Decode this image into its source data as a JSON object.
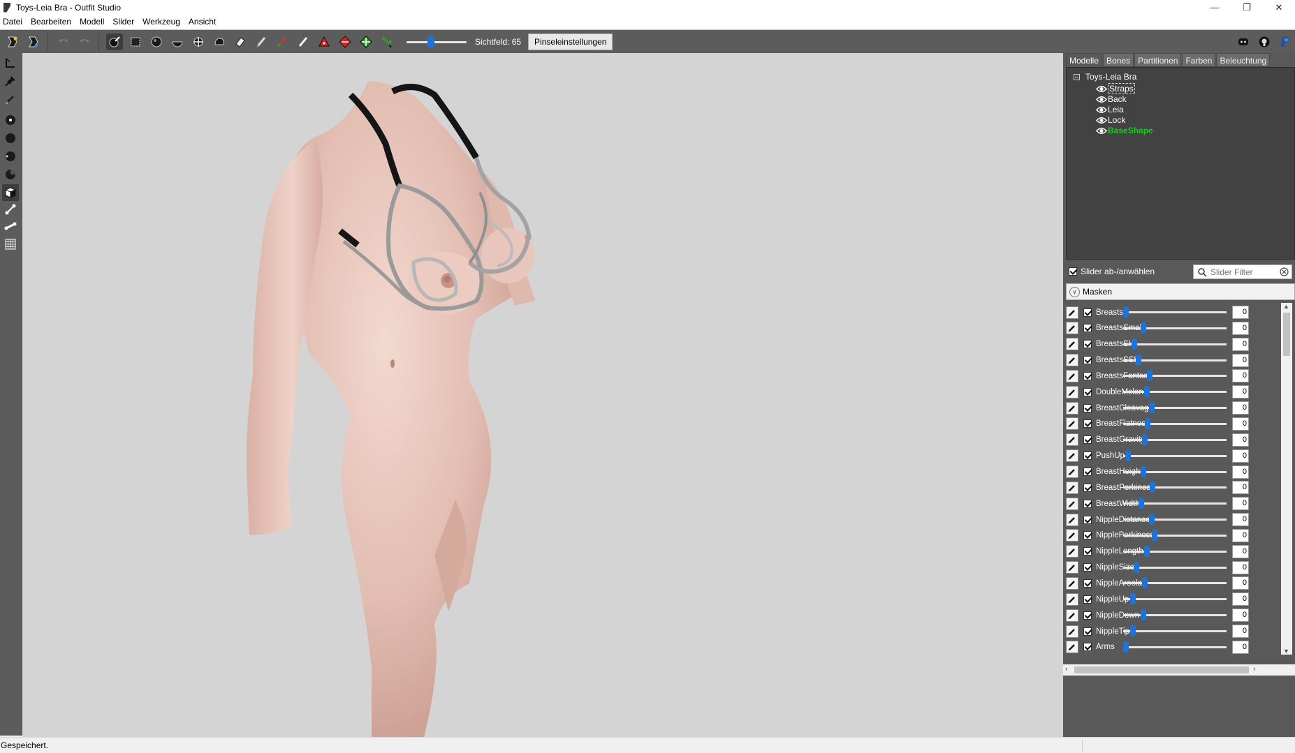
{
  "window": {
    "title": "Toys-Leia Bra - Outfit Studio",
    "minimize": "—",
    "maximize": "❐",
    "close": "✕"
  },
  "menu": [
    "Datei",
    "Bearbeiten",
    "Modell",
    "Slider",
    "Werkzeug",
    "Ansicht"
  ],
  "toolbar": {
    "fov_label": "Sichtfeld: 65",
    "fov_value": 65,
    "brush_settings": "Pinseleinstellungen"
  },
  "tabs": [
    "Modelle",
    "Bones",
    "Partitionen",
    "Farben",
    "Beleuchtung"
  ],
  "tree": {
    "root": "Toys-Leia Bra",
    "items": [
      {
        "label": "Straps",
        "selected": true
      },
      {
        "label": "Back"
      },
      {
        "label": "Leia"
      },
      {
        "label": "Lock"
      },
      {
        "label": "BaseShape",
        "reference": true
      }
    ]
  },
  "sliders_panel": {
    "select_all_label": "Slider ab-/anwählen",
    "filter_placeholder": "Slider Filter",
    "masks_label": "Masken"
  },
  "sliders": [
    {
      "name": "Breasts",
      "value": "0",
      "pos": 0.0
    },
    {
      "name": "BreastsSmall",
      "value": "0",
      "pos": 0.17
    },
    {
      "name": "BreastsSH",
      "value": "0",
      "pos": 0.08
    },
    {
      "name": "BreastsSSH",
      "value": "0",
      "pos": 0.12
    },
    {
      "name": "BreastsFantasy",
      "value": "0",
      "pos": 0.23
    },
    {
      "name": "DoubleMelon",
      "value": "0",
      "pos": 0.2
    },
    {
      "name": "BreastCleavage",
      "value": "0",
      "pos": 0.25
    },
    {
      "name": "BreastFlatness",
      "value": "0",
      "pos": 0.21
    },
    {
      "name": "BreastGravity",
      "value": "0",
      "pos": 0.18
    },
    {
      "name": "PushUp",
      "value": "0",
      "pos": 0.02
    },
    {
      "name": "BreastHeight",
      "value": "0",
      "pos": 0.17
    },
    {
      "name": "BreastPerkiness",
      "value": "0",
      "pos": 0.26
    },
    {
      "name": "BreastWidth",
      "value": "0",
      "pos": 0.15
    },
    {
      "name": "NippleDistance",
      "value": "0",
      "pos": 0.25
    },
    {
      "name": "NipplePerkiness",
      "value": "0",
      "pos": 0.28
    },
    {
      "name": "NippleLength",
      "value": "0",
      "pos": 0.2
    },
    {
      "name": "NippleSize",
      "value": "0",
      "pos": 0.1
    },
    {
      "name": "NippleAreola",
      "value": "0",
      "pos": 0.18
    },
    {
      "name": "NippleUp",
      "value": "0",
      "pos": 0.07
    },
    {
      "name": "NippleDown",
      "value": "0",
      "pos": 0.17
    },
    {
      "name": "NippleTip",
      "value": "0",
      "pos": 0.07
    },
    {
      "name": "Arms",
      "value": "0",
      "pos": 0.0
    }
  ],
  "status": "Gespeichert.",
  "colors": {
    "toolbar_bg": "#5c5c5c",
    "viewport_bg": "#d4d4d4",
    "panel_bg": "#595959",
    "accent": "#1e73d8",
    "reference_shape": "#11d311"
  }
}
